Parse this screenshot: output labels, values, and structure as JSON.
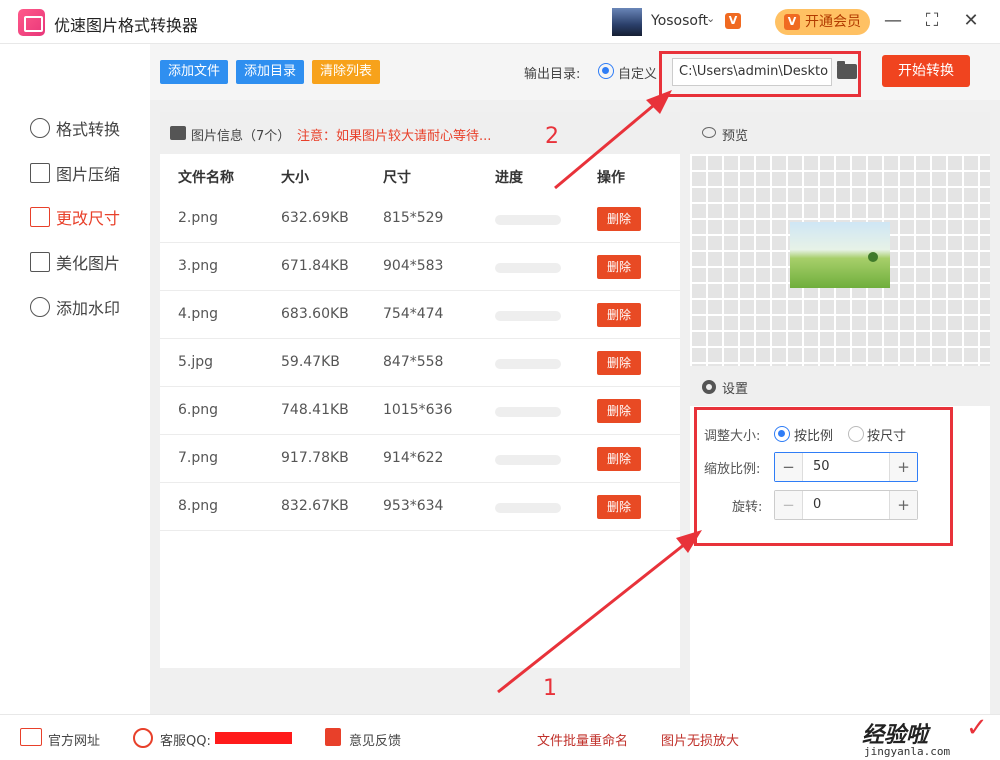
{
  "app": {
    "title": "优速图片格式转换器",
    "user_name": "Yososoft",
    "vip_button": "开通会员",
    "min": "—",
    "max": "⛶",
    "close": "✕"
  },
  "sidebar": {
    "items": [
      {
        "label": "格式转换",
        "icon": "convert-icon"
      },
      {
        "label": "图片压缩",
        "icon": "compress-icon"
      },
      {
        "label": "更改尺寸",
        "icon": "resize-icon",
        "active": true
      },
      {
        "label": "美化图片",
        "icon": "beautify-icon"
      },
      {
        "label": "添加水印",
        "icon": "watermark-icon"
      }
    ]
  },
  "toolbar": {
    "add_file": "添加文件",
    "add_folder": "添加目录",
    "clear_list": "清除列表",
    "output_label": "输出目录:",
    "custom_label": "自定义",
    "output_path": "C:\\Users\\admin\\Deskto",
    "start_button": "开始转换",
    "colors": {
      "add_file": "#2f8ff0",
      "add_folder": "#2f8ff0",
      "clear_list": "#f7a21b"
    }
  },
  "file_panel": {
    "title": "图片信息（7个）",
    "note": "注意：如果图片较大请耐心等待...",
    "columns": [
      "文件名称",
      "大小",
      "尺寸",
      "进度",
      "操作"
    ],
    "rows": [
      {
        "name": "2.png",
        "size": "632.69KB",
        "dims": "815*529",
        "progress": 0,
        "action": "删除"
      },
      {
        "name": "3.png",
        "size": "671.84KB",
        "dims": "904*583",
        "progress": 0,
        "action": "删除"
      },
      {
        "name": "4.png",
        "size": "683.60KB",
        "dims": "754*474",
        "progress": 0,
        "action": "删除"
      },
      {
        "name": "5.jpg",
        "size": "59.47KB",
        "dims": "847*558",
        "progress": 0,
        "action": "删除"
      },
      {
        "name": "6.png",
        "size": "748.41KB",
        "dims": "1015*636",
        "progress": 0,
        "action": "删除"
      },
      {
        "name": "7.png",
        "size": "917.78KB",
        "dims": "914*622",
        "progress": 0,
        "action": "删除"
      },
      {
        "name": "8.png",
        "size": "832.67KB",
        "dims": "953*634",
        "progress": 0,
        "action": "删除"
      }
    ]
  },
  "preview": {
    "title": "预览"
  },
  "settings": {
    "title": "设置",
    "resize_label": "调整大小:",
    "opt_ratio": "按比例",
    "opt_size": "按尺寸",
    "scale_label": "缩放比例:",
    "scale_value": "50",
    "rotate_label": "旋转:",
    "rotate_value": "0"
  },
  "annotations": {
    "num1": "1",
    "num2": "2"
  },
  "footer": {
    "website": "官方网址",
    "qq": "客服QQ:",
    "feedback": "意见反馈",
    "batch_rename": "文件批量重命名",
    "lossless": "图片无损放大"
  },
  "watermark": {
    "main": "经验啦",
    "sub": "jingyanla.com"
  }
}
